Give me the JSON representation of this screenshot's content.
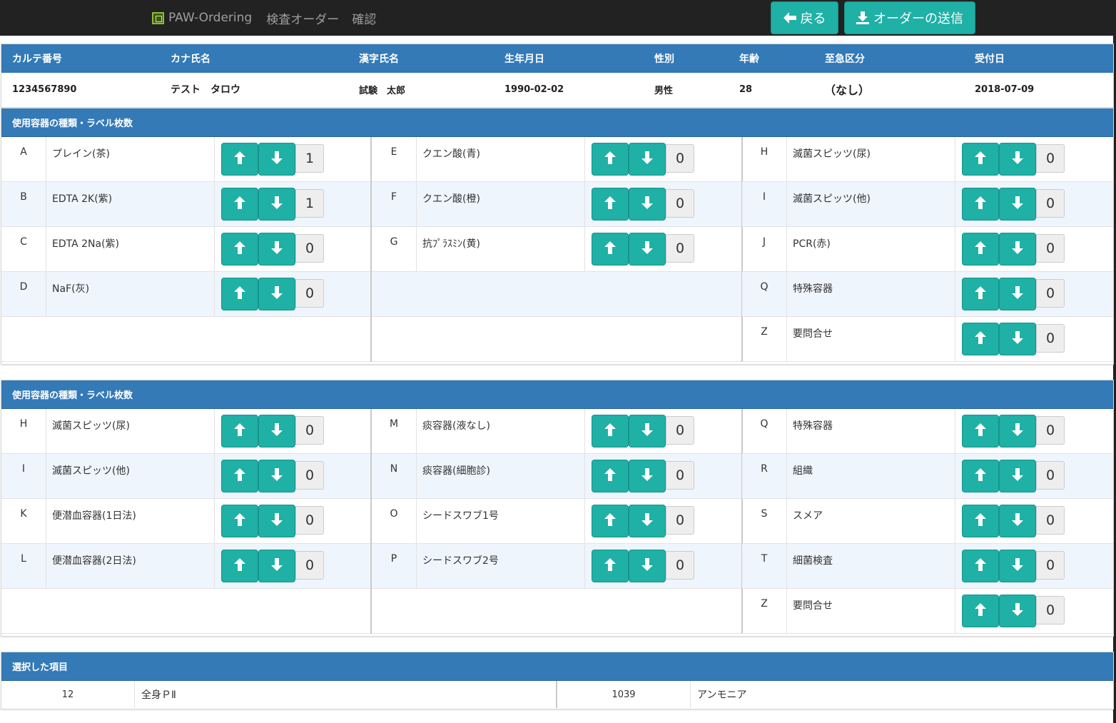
{
  "nav": {
    "brand": "PAW-Ordering",
    "section": "検査オーダー",
    "page": "確認",
    "back_label": "戻る",
    "send_label": "オーダーの送信"
  },
  "patient": {
    "headers": [
      "カルテ番号",
      "カナ氏名",
      "漢字氏名",
      "生年月日",
      "性別",
      "年齢",
      "至急区分",
      "受付日"
    ],
    "values": [
      "1234567890",
      "テスト　タロウ",
      "試験　太郎",
      "1990-02-02",
      "男性",
      "28",
      "（なし）",
      "2018-07-09"
    ]
  },
  "containers_a": {
    "title": "使用容器の種類・ラベル枚数",
    "columns": [
      [
        {
          "code": "A",
          "name": "プレイン(茶)",
          "count": "1"
        },
        {
          "code": "B",
          "name": "EDTA 2K(紫)",
          "count": "1"
        },
        {
          "code": "C",
          "name": "EDTA 2Na(紫)",
          "count": "0"
        },
        {
          "code": "D",
          "name": "NaF(灰)",
          "count": "0"
        }
      ],
      [
        {
          "code": "E",
          "name": "クエン酸(青)",
          "count": "0"
        },
        {
          "code": "F",
          "name": "クエン酸(橙)",
          "count": "0"
        },
        {
          "code": "G",
          "name": "抗ﾌﾟﾗｽﾐﾝ(黄)",
          "count": "0"
        }
      ],
      [
        {
          "code": "H",
          "name": "滅菌スピッツ(尿)",
          "count": "0"
        },
        {
          "code": "I",
          "name": "滅菌スピッツ(他)",
          "count": "0"
        },
        {
          "code": "J",
          "name": "PCR(赤)",
          "count": "0"
        },
        {
          "code": "Q",
          "name": "特殊容器",
          "count": "0"
        },
        {
          "code": "Z",
          "name": "要問合せ",
          "count": "0"
        }
      ]
    ]
  },
  "containers_b": {
    "title": "使用容器の種類・ラベル枚数",
    "columns": [
      [
        {
          "code": "H",
          "name": "滅菌スピッツ(尿)",
          "count": "0"
        },
        {
          "code": "I",
          "name": "滅菌スピッツ(他)",
          "count": "0"
        },
        {
          "code": "K",
          "name": "便潜血容器(1日法)",
          "count": "0"
        },
        {
          "code": "L",
          "name": "便潜血容器(2日法)",
          "count": "0"
        }
      ],
      [
        {
          "code": "M",
          "name": "痰容器(液なし)",
          "count": "0"
        },
        {
          "code": "N",
          "name": "痰容器(細胞診)",
          "count": "0"
        },
        {
          "code": "O",
          "name": "シードスワブ1号",
          "count": "0"
        },
        {
          "code": "P",
          "name": "シードスワブ2号",
          "count": "0"
        }
      ],
      [
        {
          "code": "Q",
          "name": "特殊容器",
          "count": "0"
        },
        {
          "code": "R",
          "name": "組織",
          "count": "0"
        },
        {
          "code": "S",
          "name": "スメア",
          "count": "0"
        },
        {
          "code": "T",
          "name": "細菌検査",
          "count": "0"
        },
        {
          "code": "Z",
          "name": "要問合せ",
          "count": "0"
        }
      ]
    ]
  },
  "selected": {
    "title": "選択した項目",
    "items": [
      {
        "code": "12",
        "name": "全身ＰⅡ"
      },
      {
        "code": "1039",
        "name": "アンモニア"
      }
    ]
  },
  "colors": {
    "navbar": "#222222",
    "panel_header": "#337ab7",
    "button": "#1fb0a6",
    "row_alt": "#eef5fc"
  }
}
